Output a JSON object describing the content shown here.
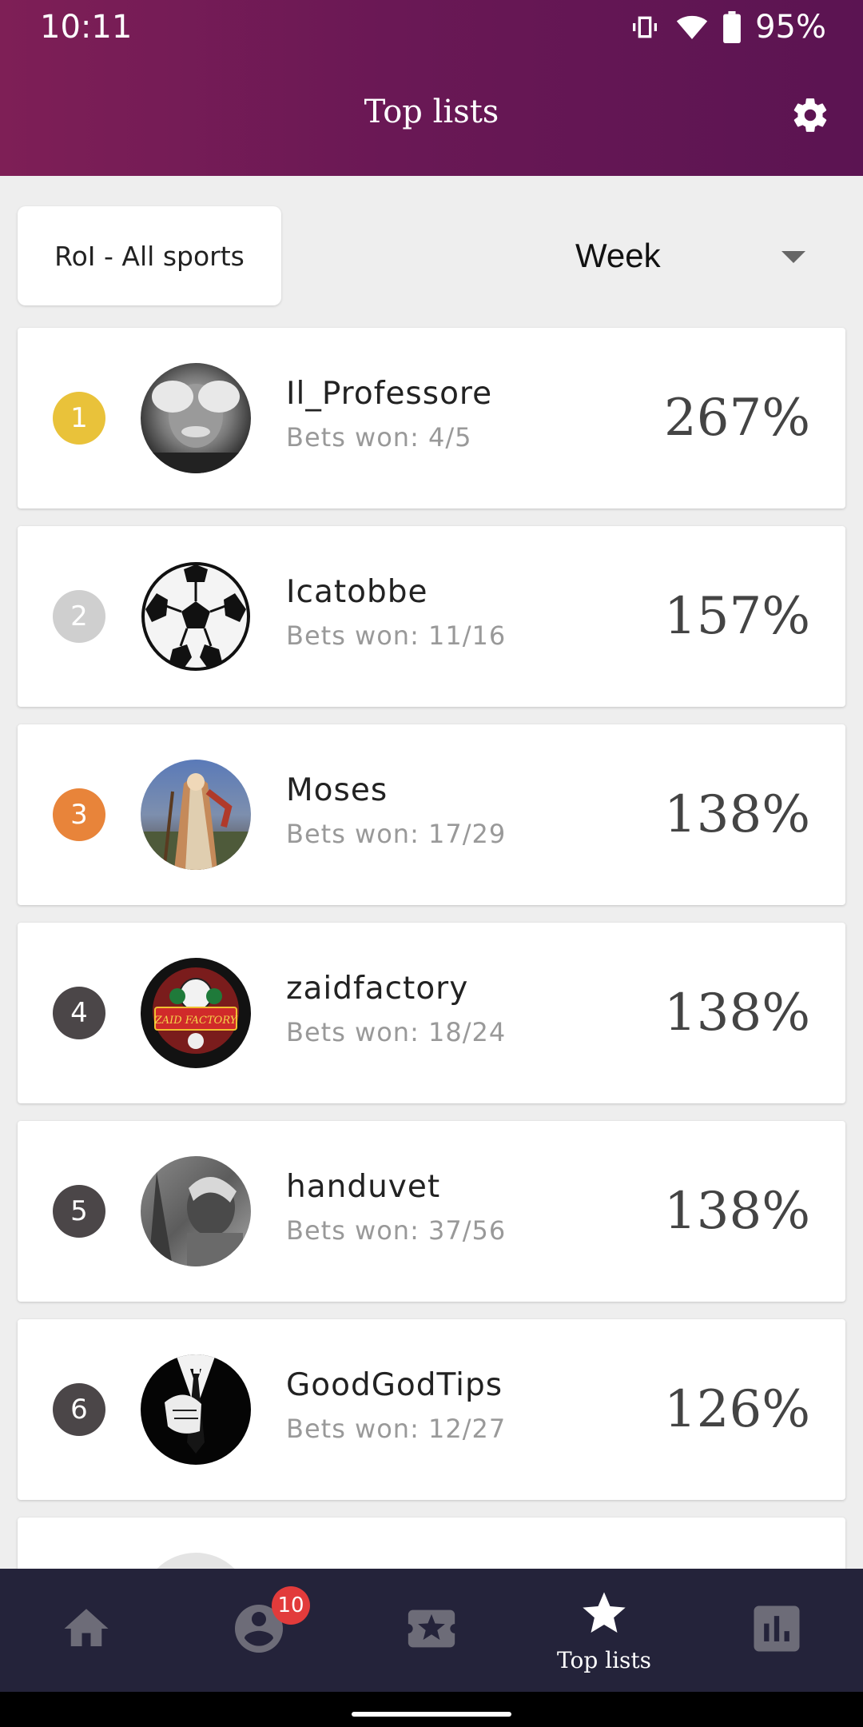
{
  "status": {
    "time": "10:11",
    "battery": "95%"
  },
  "header": {
    "title": "Top lists"
  },
  "filters": {
    "metric_label": "RoI - All sports",
    "period_label": "Week"
  },
  "entries": [
    {
      "rank": "1",
      "name": "Il_Professore",
      "bets": "Bets won: 4/5",
      "roi": "267%",
      "badge_color": "#e9c23a",
      "avatar": "portrait-avatar"
    },
    {
      "rank": "2",
      "name": "Icatobbe",
      "bets": "Bets won: 11/16",
      "roi": "157%",
      "badge_color": "#cfcfcf",
      "avatar": "soccer-ball-avatar"
    },
    {
      "rank": "3",
      "name": "Moses",
      "bets": "Bets won: 17/29",
      "roi": "138%",
      "badge_color": "#e8843a",
      "avatar": "painting-avatar"
    },
    {
      "rank": "4",
      "name": "zaidfactory",
      "bets": "Bets won: 18/24",
      "roi": "138%",
      "badge_color": "#4b4648",
      "avatar": "logo-avatar"
    },
    {
      "rank": "5",
      "name": "handuvet",
      "bets": "Bets won: 37/56",
      "roi": "138%",
      "badge_color": "#4b4648",
      "avatar": "photo-avatar"
    },
    {
      "rank": "6",
      "name": "GoodGodTips",
      "bets": "Bets won: 12/27",
      "roi": "126%",
      "badge_color": "#4b4648",
      "avatar": "suit-avatar"
    }
  ],
  "nav": {
    "items": [
      {
        "icon": "home-icon",
        "label": ""
      },
      {
        "icon": "profile-icon",
        "label": "",
        "badge": "10"
      },
      {
        "icon": "ticket-icon",
        "label": ""
      },
      {
        "icon": "star-icon",
        "label": "Top lists"
      },
      {
        "icon": "bar-chart-icon",
        "label": ""
      }
    ]
  },
  "colors": {
    "header_start": "#7e1f56",
    "header_end": "#5b1452",
    "nav_bg": "#24233a",
    "nav_inactive": "#6d6c78"
  }
}
